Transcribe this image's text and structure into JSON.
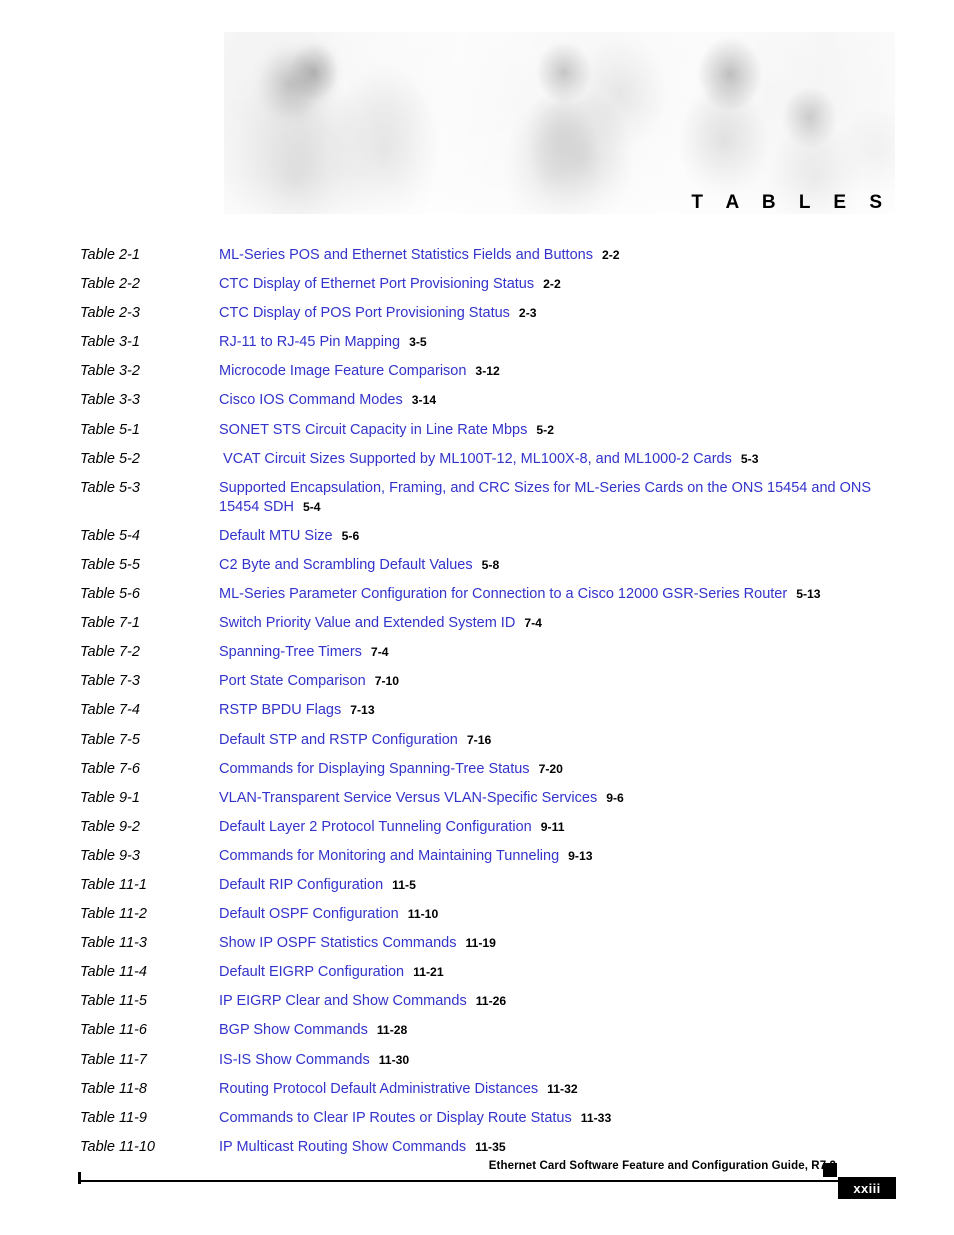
{
  "banner": {
    "title": "T A B L E S",
    "alt": "cisco-people-photo-banner"
  },
  "toc": {
    "rows": [
      {
        "label": "Table 2-1",
        "title": "ML-Series POS and Ethernet Statistics Fields and Buttons",
        "page": "2-2"
      },
      {
        "label": "Table 2-2",
        "title": "CTC Display of Ethernet Port Provisioning Status",
        "page": "2-2"
      },
      {
        "label": "Table 2-3",
        "title": "CTC Display of POS Port Provisioning Status",
        "page": "2-3"
      },
      {
        "label": "Table 3-1",
        "title": "RJ-11 to RJ-45 Pin Mapping",
        "page": "3-5"
      },
      {
        "label": "Table 3-2",
        "title": "Microcode Image Feature Comparison",
        "page": "3-12"
      },
      {
        "label": "Table 3-3",
        "title": "Cisco IOS Command Modes",
        "page": "3-14"
      },
      {
        "label": "Table 5-1",
        "title": "SONET STS Circuit Capacity in Line Rate Mbps",
        "page": "5-2"
      },
      {
        "label": "Table 5-2",
        "title": " VCAT Circuit Sizes Supported by ML100T-12, ML100X-8, and ML1000-2 Cards",
        "page": "5-3"
      },
      {
        "label": "Table 5-3",
        "title": "Supported Encapsulation, Framing, and CRC Sizes for ML-Series Cards on the ONS 15454 and ONS 15454 SDH",
        "page": "5-4"
      },
      {
        "label": "Table 5-4",
        "title": "Default MTU Size",
        "page": "5-6"
      },
      {
        "label": "Table 5-5",
        "title": "C2 Byte and Scrambling Default Values",
        "page": "5-8"
      },
      {
        "label": "Table 5-6",
        "title": "ML-Series Parameter Configuration for Connection to a Cisco 12000 GSR-Series Router",
        "page": "5-13"
      },
      {
        "label": "Table 7-1",
        "title": "Switch Priority Value and Extended System ID",
        "page": "7-4"
      },
      {
        "label": "Table 7-2",
        "title": "Spanning-Tree Timers",
        "page": "7-4"
      },
      {
        "label": "Table 7-3",
        "title": "Port State Comparison",
        "page": "7-10"
      },
      {
        "label": "Table 7-4",
        "title": "RSTP BPDU Flags",
        "page": "7-13"
      },
      {
        "label": "Table 7-5",
        "title": "Default STP and RSTP Configuration",
        "page": "7-16"
      },
      {
        "label": "Table 7-6",
        "title": "Commands for Displaying Spanning-Tree Status",
        "page": "7-20"
      },
      {
        "label": "Table 9-1",
        "title": "VLAN-Transparent Service Versus VLAN-Specific Services",
        "page": "9-6"
      },
      {
        "label": "Table 9-2",
        "title": "Default Layer 2 Protocol Tunneling Configuration",
        "page": "9-11"
      },
      {
        "label": "Table 9-3",
        "title": "Commands for Monitoring and Maintaining Tunneling",
        "page": "9-13"
      },
      {
        "label": "Table 11-1",
        "title": "Default RIP Configuration",
        "page": "11-5"
      },
      {
        "label": "Table 11-2",
        "title": "Default OSPF Configuration",
        "page": "11-10"
      },
      {
        "label": "Table 11-3",
        "title": "Show IP OSPF Statistics Commands",
        "page": "11-19"
      },
      {
        "label": "Table 11-4",
        "title": "Default EIGRP Configuration",
        "page": "11-21"
      },
      {
        "label": "Table 11-5",
        "title": "IP EIGRP Clear and Show Commands",
        "page": "11-26"
      },
      {
        "label": "Table 11-6",
        "title": "BGP Show Commands",
        "page": "11-28"
      },
      {
        "label": "Table 11-7",
        "title": "IS-IS Show Commands",
        "page": "11-30"
      },
      {
        "label": "Table 11-8",
        "title": "Routing Protocol Default Administrative Distances",
        "page": "11-32"
      },
      {
        "label": "Table 11-9",
        "title": "Commands to Clear IP Routes or Display Route Status",
        "page": "11-33"
      },
      {
        "label": "Table 11-10",
        "title": "IP Multicast Routing Show Commands",
        "page": "11-35"
      }
    ]
  },
  "footer": {
    "document_title": "Ethernet Card Software Feature and Configuration Guide, R7.2",
    "page_number": "xxiii"
  },
  "colors": {
    "link": "#3333CC",
    "text": "#000000",
    "footer_badge_bg": "#000000",
    "footer_badge_text": "#FFFFFF"
  }
}
